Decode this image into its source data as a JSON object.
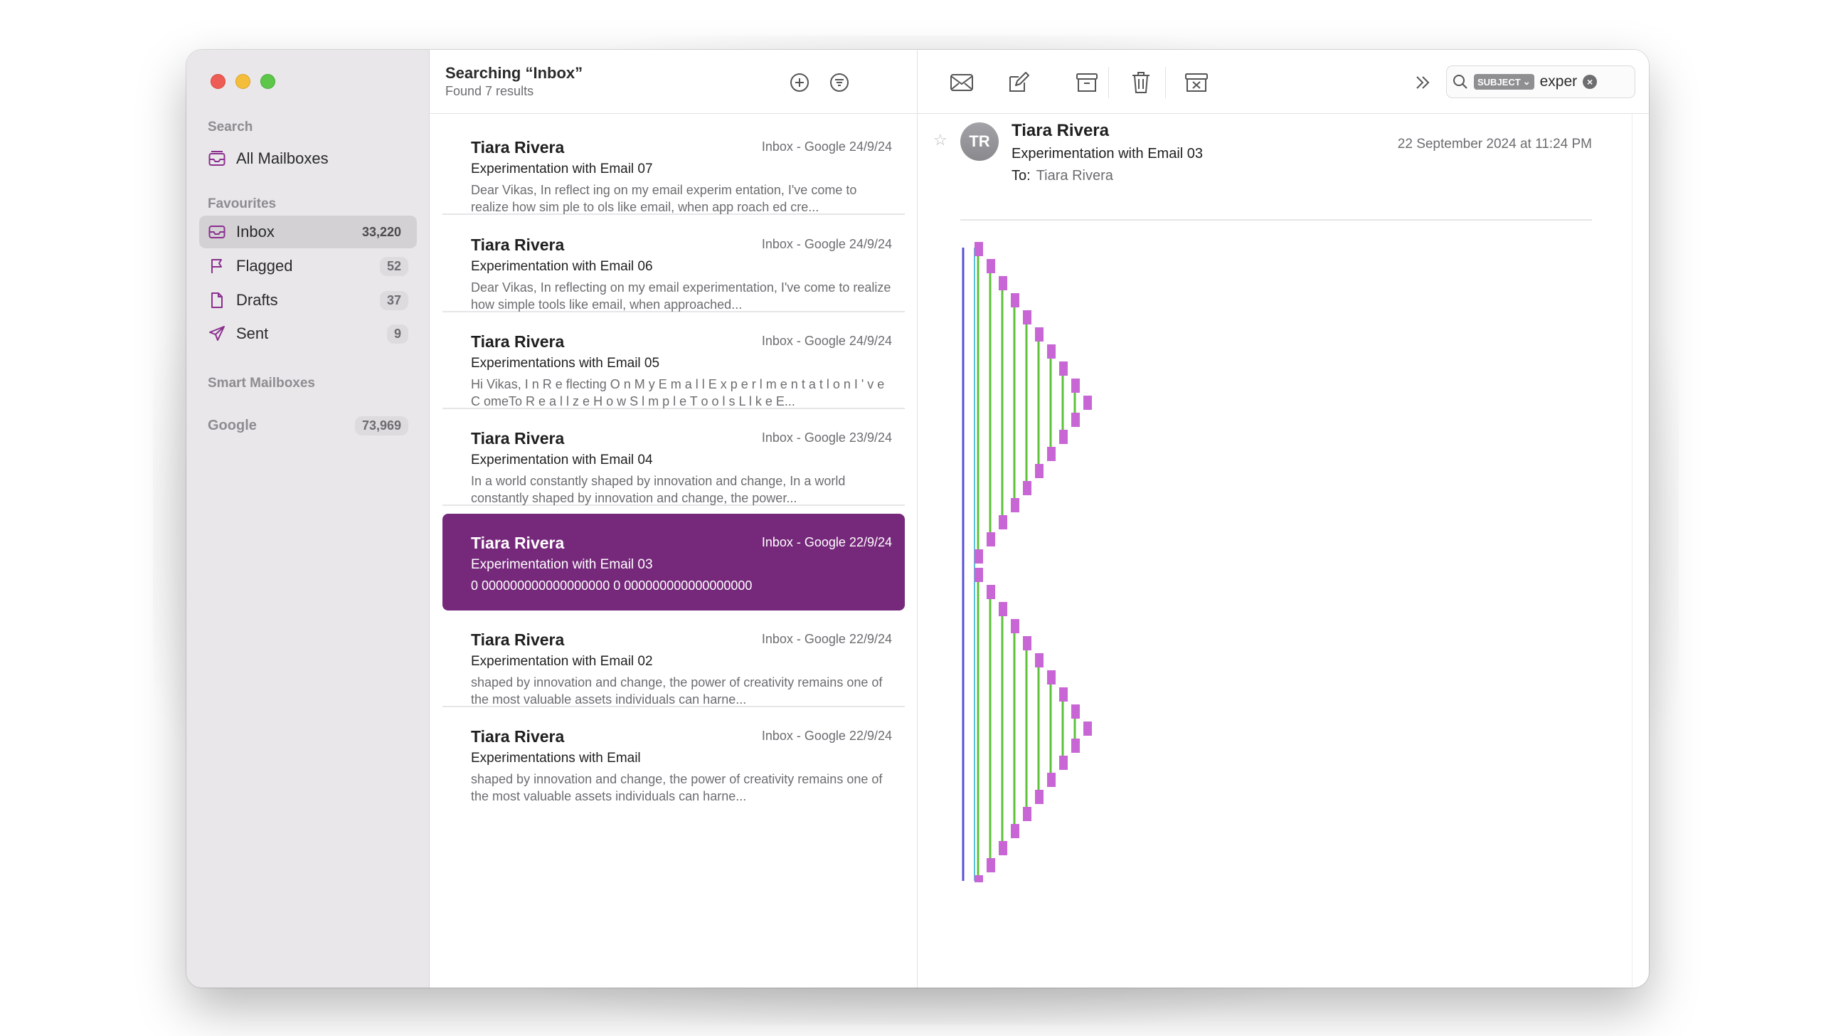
{
  "sidebar": {
    "search_label": "Search",
    "all_mailboxes": "All Mailboxes",
    "favourites_label": "Favourites",
    "items": [
      {
        "label": "Inbox",
        "count": "33,220"
      },
      {
        "label": "Flagged",
        "count": "52"
      },
      {
        "label": "Drafts",
        "count": "37"
      },
      {
        "label": "Sent",
        "count": "9"
      }
    ],
    "smart_label": "Smart Mailboxes",
    "google": {
      "label": "Google",
      "count": "73,969"
    }
  },
  "list": {
    "title": "Searching “Inbox”",
    "subtitle": "Found 7 results",
    "messages": [
      {
        "from": "Tiara Rivera",
        "meta": "Inbox - Google   24/9/24",
        "subject": "Experimentation with Email 07",
        "preview": "Dear Vikas, In reflect ing on my email experim entation, I've come to realize how sim ple to ols like email, when app roach ed cre..."
      },
      {
        "from": "Tiara Rivera",
        "meta": "Inbox - Google   24/9/24",
        "subject": "Experimentation with Email 06",
        "preview": "Dear Vikas, In reflecting on my email experimentation, I've come to realize how simple tools like email, when approached..."
      },
      {
        "from": "Tiara Rivera",
        "meta": "Inbox - Google   24/9/24",
        "subject": "Experimentations with Email 05",
        "preview": "Hi Vikas, I n R e flecting O n M y E m a l l E x p e r l m e n t a t l o n I ' v e C omeTo R e a l l z e H o w S l m p l e T o o l s L l k e E..."
      },
      {
        "from": "Tiara Rivera",
        "meta": "Inbox - Google   23/9/24",
        "subject": "Experimentation with Email 04",
        "preview": "In a world constantly shaped by innovation and change, In a world constantly shaped by innovation and change, the power..."
      },
      {
        "from": "Tiara Rivera",
        "meta": "Inbox - Google   22/9/24",
        "subject": "Experimentation with Email 03",
        "preview": "0 000000000000000000 0 000000000000000000"
      },
      {
        "from": "Tiara Rivera",
        "meta": "Inbox - Google   22/9/24",
        "subject": "Experimentation with Email 02",
        "preview": "shaped by innovation and change, the power of creativity remains one of the most valuable assets individuals can harne..."
      },
      {
        "from": "Tiara Rivera",
        "meta": "Inbox - Google   22/9/24",
        "subject": "Experimentations with Email",
        "preview": "shaped by innovation and change, the power of creativity remains one of the most valuable assets individuals can harne..."
      }
    ]
  },
  "reader": {
    "search_token": "SUBJECT",
    "search_query": "exper",
    "avatar_initials": "TR",
    "from": "Tiara Rivera",
    "subject": "Experimentation with Email 03",
    "to_label": "To:",
    "to_value": "Tiara Rivera",
    "date": "22 September 2024 at 11:24 PM"
  },
  "colors": {
    "accent": "#76297b",
    "art_blue": "#5a4fd6",
    "art_cyan": "#5bc0d8",
    "art_green": "#5ec23b",
    "art_magenta": "#c866d6"
  }
}
